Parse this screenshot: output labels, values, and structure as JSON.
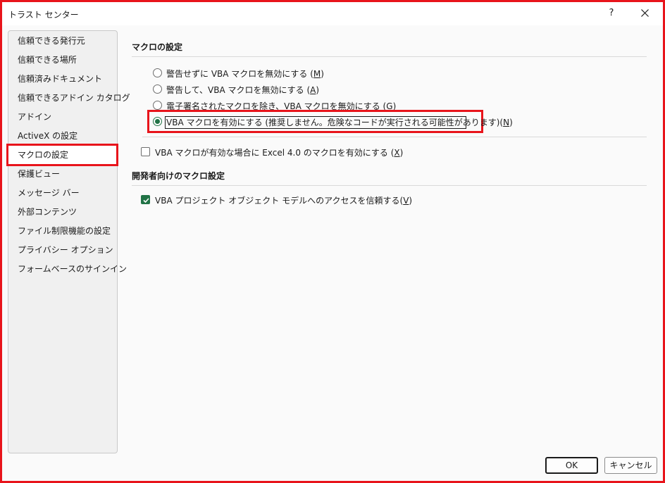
{
  "window": {
    "title": "トラスト センター",
    "help_label": "?"
  },
  "sidebar": {
    "items": [
      {
        "label": "信頼できる発行元"
      },
      {
        "label": "信頼できる場所"
      },
      {
        "label": "信頼済みドキュメント"
      },
      {
        "label": "信頼できるアドイン カタログ"
      },
      {
        "label": "アドイン"
      },
      {
        "label": "ActiveX の設定"
      },
      {
        "label": "マクロの設定",
        "selected": true
      },
      {
        "label": "保護ビュー"
      },
      {
        "label": "メッセージ バー"
      },
      {
        "label": "外部コンテンツ"
      },
      {
        "label": "ファイル制限機能の設定"
      },
      {
        "label": "プライバシー オプション"
      },
      {
        "label": "フォームベースのサインイン"
      }
    ]
  },
  "macro_settings": {
    "title": "マクロの設定",
    "options": [
      {
        "label": "警告せずに VBA マクロを無効にする (",
        "key": "M",
        "suffix": ")",
        "checked": false
      },
      {
        "label": "警告して、VBA マクロを無効にする (",
        "key": "A",
        "suffix": ")",
        "checked": false
      },
      {
        "label": "電子署名されたマクロを除き、VBA マクロを無効にする (",
        "key": "G",
        "suffix": ")",
        "checked": false
      },
      {
        "label": "VBA マクロを有効にする (推奨しません。危険なコードが実行される可能性があります)(",
        "key": "N",
        "suffix": ")",
        "checked": true
      }
    ],
    "excel4": {
      "label": "VBA マクロが有効な場合に Excel 4.0 のマクロを有効にする (",
      "key": "X",
      "suffix": ")",
      "checked": false
    }
  },
  "developer_settings": {
    "title": "開発者向けのマクロ設定",
    "vba_trust": {
      "label": "VBA プロジェクト オブジェクト モデルへのアクセスを信頼する(",
      "key": "V",
      "suffix": ")",
      "checked": true
    }
  },
  "buttons": {
    "ok": "OK",
    "cancel": "キャンセル"
  },
  "colors": {
    "accent": "#217346",
    "highlight": "#e8141b"
  }
}
